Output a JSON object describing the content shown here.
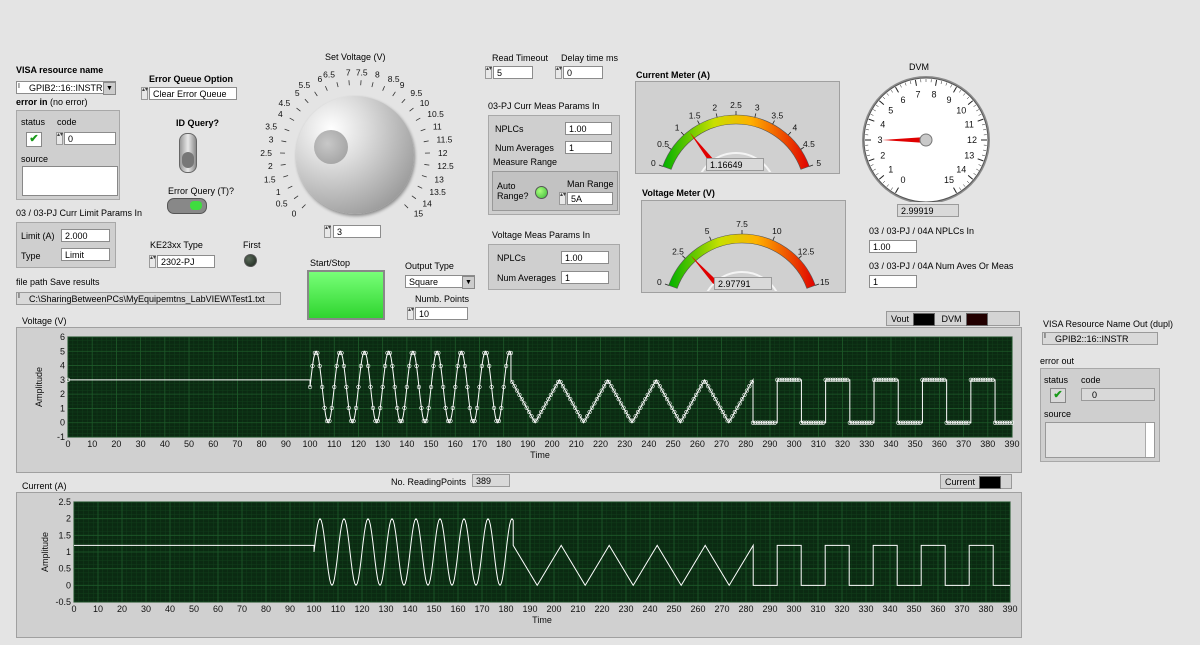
{
  "visa": {
    "label": "VISA resource name",
    "value": "GPIB2::16::INSTR",
    "icon": "visa-resource-icon"
  },
  "error_in": {
    "label": "error in",
    "sublabel": "(no error)",
    "status_label": "status",
    "code_label": "code",
    "code_value": "0",
    "source_label": "source"
  },
  "error_queue": {
    "label": "Error Queue Option",
    "value": "Clear Error Queue"
  },
  "id_query": {
    "label": "ID Query?"
  },
  "error_query": {
    "label": "Error Query (T)?"
  },
  "curr_limit": {
    "title": "03 / 03-PJ Curr Limit Params In",
    "limit_label": "Limit (A)",
    "limit_value": "2.000",
    "type_label": "Type",
    "type_value": "Limit"
  },
  "ke_type": {
    "label": "KE23xx Type",
    "value": "2302-PJ"
  },
  "first": {
    "label": "First"
  },
  "file_path": {
    "label": "file path Save results",
    "value": "C:\\SharingBetweenPCs\\MyEquipemtns_LabVIEW\\Test1.txt"
  },
  "set_voltage": {
    "label": "Set Voltage (V)",
    "value": "3",
    "scale": [
      "0",
      "0.5",
      "1",
      "1.5",
      "2",
      "2.5",
      "3",
      "3.5",
      "4",
      "4.5",
      "5",
      "5.5",
      "6",
      "6.5",
      "7",
      "7.5",
      "8",
      "8.5",
      "9",
      "9.5",
      "10",
      "10.5",
      "11",
      "11.5",
      "12",
      "12.5",
      "13",
      "13.5",
      "14",
      "15"
    ]
  },
  "start_stop": {
    "label": "Start/Stop"
  },
  "output_type": {
    "label": "Output Type",
    "value": "Square"
  },
  "numb_points": {
    "label": "Numb. Points",
    "value": "10"
  },
  "read_timeout": {
    "label": "Read Timeout",
    "value": "5"
  },
  "delay_time": {
    "label": "Delay time ms",
    "value": "0"
  },
  "curr_meas": {
    "title": "03-PJ Curr Meas Params In",
    "nplc_label": "NPLCs",
    "nplc_value": "1.00",
    "avg_label": "Num Averages",
    "avg_value": "1",
    "range_label": "Measure Range",
    "auto_label": "Auto Range?",
    "man_label": "Man Range",
    "man_value": "5A"
  },
  "volt_meas": {
    "title": "Voltage Meas Params In",
    "nplc_label": "NPLCs",
    "nplc_value": "1.00",
    "avg_label": "Num Averages",
    "avg_value": "1"
  },
  "current_meter": {
    "label": "Current Meter (A)",
    "value": "1.16649",
    "reading": 1.16649,
    "min": 0,
    "max": 5,
    "ticks": [
      "0",
      "0.5",
      "1",
      "1.5",
      "2",
      "2.5",
      "3",
      "3.5",
      "4",
      "4.5",
      "5"
    ]
  },
  "voltage_meter": {
    "label": "Voltage Meter (V)",
    "value": "2.97791",
    "reading": 2.97791,
    "min": 0,
    "max": 15,
    "ticks": [
      "0",
      "2.5",
      "5",
      "7.5",
      "10",
      "12.5",
      "15"
    ]
  },
  "dvm": {
    "label": "DVM",
    "value": "2.99919",
    "reading": 2.99919,
    "ticks": [
      "0",
      "1",
      "2",
      "3",
      "4",
      "5",
      "6",
      "7",
      "8",
      "9",
      "10",
      "11",
      "12",
      "13",
      "14",
      "15"
    ]
  },
  "nplc_in": {
    "label": "03 / 03-PJ / 04A NPLCs In",
    "value": "1.00"
  },
  "num_aves": {
    "label": "03 / 03-PJ / 04A Num Aves Or Meas",
    "value": "1"
  },
  "visa_out": {
    "label": "VISA Resource Name Out (dupl)",
    "value": "GPIB2::16::INSTR"
  },
  "error_out": {
    "label": "error out",
    "status_label": "status",
    "code_label": "code",
    "code_value": "0",
    "source_label": "source"
  },
  "voltage_chart": {
    "label": "Voltage (V)",
    "legend_vout": "Vout",
    "legend_dvm": "DVM"
  },
  "current_chart": {
    "label": "Current (A)",
    "legend_current": "Current",
    "reading_points_label": "No. ReadingPoints",
    "reading_points_value": "389"
  },
  "colors": {
    "plot_bg": "#0b2a12",
    "grid": "#1e5a2a",
    "trace": "#ffffff",
    "led_on": "#4be04b",
    "start_btn": "#3de83d"
  },
  "chart_data": [
    {
      "type": "line",
      "title": "Voltage (V)",
      "xlabel": "Time",
      "ylabel": "Amplitude",
      "xlim": [
        0,
        390
      ],
      "ylim": [
        -1,
        6
      ],
      "xticks": [
        "0",
        "10",
        "20",
        "30",
        "40",
        "50",
        "60",
        "70",
        "80",
        "90",
        "100",
        "110",
        "120",
        "130",
        "140",
        "150",
        "160",
        "170",
        "180",
        "190",
        "200",
        "210",
        "220",
        "230",
        "240",
        "250",
        "260",
        "270",
        "280",
        "290",
        "300",
        "310",
        "320",
        "330",
        "340",
        "350",
        "360",
        "370",
        "380",
        "390"
      ],
      "yticks": [
        "-1",
        "0",
        "1",
        "2",
        "3",
        "4",
        "5",
        "6"
      ],
      "series": [
        {
          "name": "Vout",
          "segments": [
            {
              "kind": "const",
              "x0": 0,
              "x1": 100,
              "y": 3
            },
            {
              "kind": "sine",
              "x0": 100,
              "x1": 183,
              "period": 10,
              "mid": 2.5,
              "amp": 2.5
            },
            {
              "kind": "tri",
              "x0": 183,
              "x1": 283,
              "period": 20,
              "lo": 0,
              "hi": 3
            },
            {
              "kind": "square",
              "x0": 283,
              "x1": 390,
              "period": 20,
              "lo": 0,
              "hi": 3
            }
          ]
        }
      ]
    },
    {
      "type": "line",
      "title": "Current (A)",
      "xlabel": "Time",
      "ylabel": "Amplitude",
      "xlim": [
        0,
        390
      ],
      "ylim": [
        -0.5,
        2.5
      ],
      "xticks": [
        "0",
        "10",
        "20",
        "30",
        "40",
        "50",
        "60",
        "70",
        "80",
        "90",
        "100",
        "110",
        "120",
        "130",
        "140",
        "150",
        "160",
        "170",
        "180",
        "190",
        "200",
        "210",
        "220",
        "230",
        "240",
        "250",
        "260",
        "270",
        "280",
        "290",
        "300",
        "310",
        "320",
        "330",
        "340",
        "350",
        "360",
        "370",
        "380",
        "390"
      ],
      "yticks": [
        "-0.5",
        "0",
        "0.5",
        "1",
        "1.5",
        "2",
        "2.5"
      ],
      "series": [
        {
          "name": "Current",
          "segments": [
            {
              "kind": "const",
              "x0": 0,
              "x1": 100,
              "y": 1.2
            },
            {
              "kind": "sine",
              "x0": 100,
              "x1": 183,
              "period": 10,
              "mid": 1,
              "amp": 1
            },
            {
              "kind": "tri",
              "x0": 183,
              "x1": 283,
              "period": 20,
              "lo": 0,
              "hi": 1.2
            },
            {
              "kind": "square",
              "x0": 283,
              "x1": 390,
              "period": 20,
              "lo": 0,
              "hi": 1.2
            }
          ]
        }
      ]
    }
  ]
}
